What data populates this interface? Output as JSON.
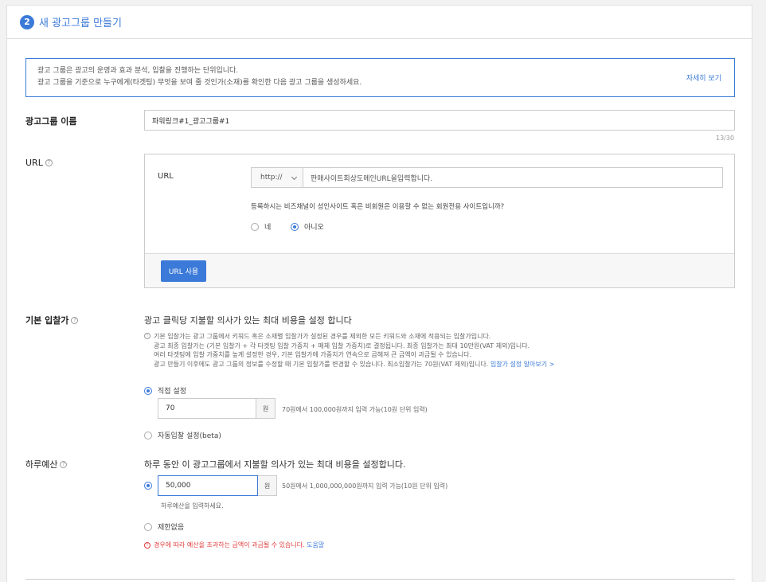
{
  "header": {
    "step": "2",
    "title": "새 광고그룹 만들기"
  },
  "info": {
    "line1": "광고 그룹은 광고의 운영과 효과 분석, 입찰을 진행하는 단위입니다.",
    "line2": "광고 그룹을 기준으로 누구에게(타겟팅) 무엇을 보여 줄 것인가(소재)를 확인한 다음 광고 그룹을 생성하세요.",
    "more_link": "자세히 보기"
  },
  "ad_group_name": {
    "label": "광고그룹 이름",
    "value": "파워링크#1_광고그룹#1",
    "counter": "13/30"
  },
  "url_section": {
    "label": "URL",
    "inner_label": "URL",
    "protocol": "http://",
    "input_placeholder": "판매사이트회상도메인URL을입력합니다.",
    "question": "등록하시는 비즈채널이 성인사이트 혹은 비회원은 이용할 수 없는 회원전용 사이트입니까?",
    "option_yes": "네",
    "option_no": "아니오",
    "use_button": "URL 사용"
  },
  "default_bid": {
    "label": "기본 입찰가",
    "heading": "광고 클릭당 지불할 의사가 있는 최대 비용을 설정 합니다",
    "desc1": "기본 입찰가는 광고 그룹에서 키워드 혹은 소재별 입찰가가 설정된 경우를 제외한 모든 키워드와 소재에 적용되는 입찰가입니다.",
    "desc2": "광고 최종 입찰가는 (기본 입찰가 + 각 타겟팅 입찰 가중치 + 매체 입찰 가중치)로 결정됩니다. 최종 입찰가는 최대 10만원(VAT 제외)입니다.",
    "desc3": "여러 타겟팅에 입찰 가중치를 높게 설정한 경우, 기본 입찰가에 가중치가 연속으로 곱해져 큰 금액이 과금될 수 있습니다.",
    "desc4": "광고 만들기 이후에도 광고 그룹의 정보를 수정할 때 기본 입찰가를 변경할 수 있습니다. 최소입찰가는 70원(VAT 제외)입니다.",
    "desc4_link": "입찰가 설정 알아보기 >",
    "option_manual": "직접 설정",
    "value": "70",
    "unit": "원",
    "range_hint": "70원에서 100,000원까지 입력 가능(10원 단위 입력)",
    "option_auto": "자동입찰 설정(beta)"
  },
  "daily_budget": {
    "label": "하루예산",
    "heading": "하루 동안 이 광고그룹에서 지불할 의사가 있는 최대 비용을 설정합니다.",
    "value": "50,000",
    "unit": "원",
    "range_hint": "50원에서 1,000,000,000원까지 입력 가능(10원 단위 입력)",
    "input_hint": "하루예산을 입력하세요.",
    "option_unlimited": "제한없음",
    "warning": "경우에 따라 예산을 초과하는 금액이 과금될 수 있습니다.",
    "help_link": "도움말"
  }
}
